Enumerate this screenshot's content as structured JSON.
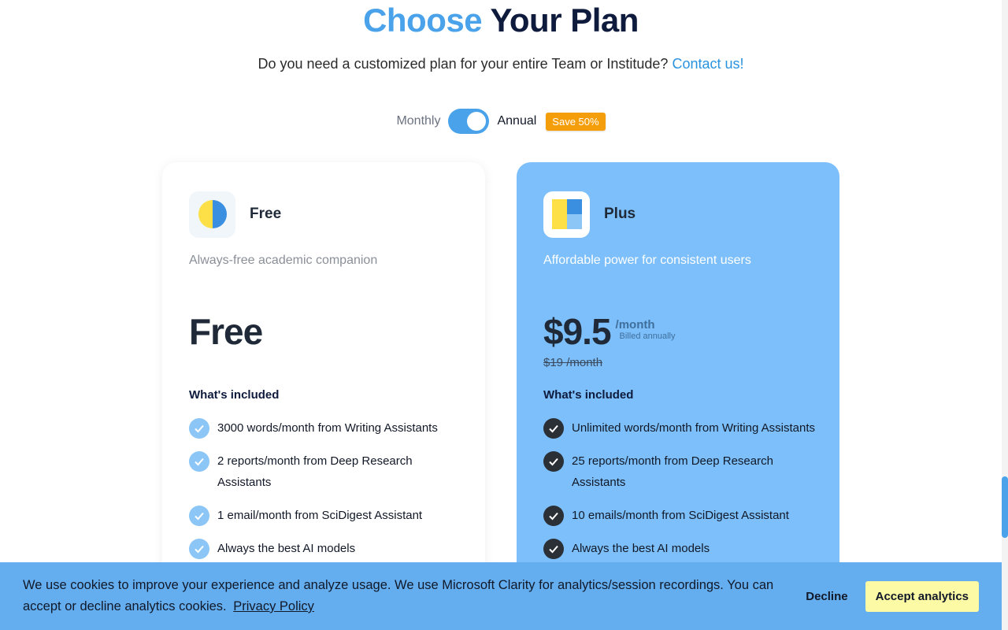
{
  "header": {
    "title_accent": "Choose",
    "title_rest": "Your Plan",
    "subtitle": "Do you need a customized plan for your entire Team or Institude?",
    "contact_link": "Contact us!"
  },
  "billing": {
    "monthly_label": "Monthly",
    "annual_label": "Annual",
    "selected": "Annual",
    "save_badge": "Save 50%"
  },
  "plans": [
    {
      "name": "Free",
      "description": "Always-free academic companion",
      "price": "Free",
      "included_label": "What's included",
      "features": [
        "3000 words/month from Writing Assistants",
        "2 reports/month from Deep Research Assistants",
        "1 email/month from SciDigest Assistant",
        "Always the best AI models"
      ]
    },
    {
      "name": "Plus",
      "description": "Affordable power for consistent users",
      "price": "$9.5",
      "per": "/month",
      "billed": "Billed annually",
      "old_price": "$19 /month",
      "included_label": "What's included",
      "features": [
        "Unlimited words/month from Writing Assistants",
        "25 reports/month from Deep Research Assistants",
        "10 emails/month from SciDigest Assistant",
        "Always the best AI models"
      ]
    }
  ],
  "cookie": {
    "text": "We use cookies to improve your experience and analyze usage. We use Microsoft Clarity for analytics/session recordings. You can accept or decline analytics cookies.",
    "policy_link": "Privacy Policy",
    "decline_label": "Decline",
    "accept_label": "Accept analytics"
  },
  "colors": {
    "accent": "#4aa3ea",
    "plus_card": "#7cbffa",
    "badge": "#f59e0b",
    "cookie_banner": "#64aef0",
    "accept_button": "#fdfaa6"
  },
  "icons": {
    "free_plan": "half-circle-icon",
    "plus_plan": "panels-icon",
    "feature": "check-icon"
  }
}
